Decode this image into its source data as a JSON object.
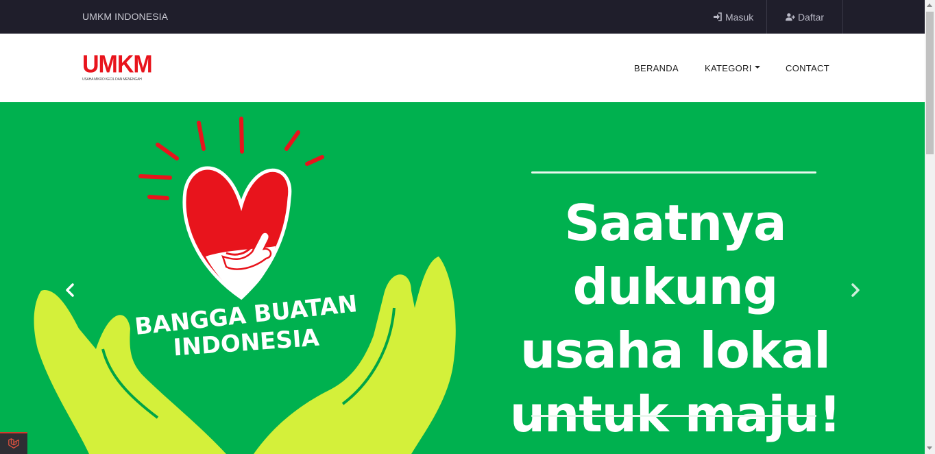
{
  "topbar": {
    "brand": "UMKM INDONESIA",
    "login_label": "Masuk",
    "register_label": "Daftar",
    "login_icon": "sign-in-icon",
    "register_icon": "user-plus-icon"
  },
  "logo": {
    "wordmark": "UMKM",
    "tagline": "USAHA MIKRO KECIL DAN MENENGAH"
  },
  "nav": {
    "items": [
      {
        "label": "BERANDA"
      },
      {
        "label": "KATEGORI",
        "has_dropdown": true
      },
      {
        "label": "CONTACT"
      }
    ]
  },
  "hero": {
    "badge_line1": "BANGGA BUATAN",
    "badge_line2": "INDONESIA",
    "headline_line1": "Saatnya dukung",
    "headline_line2": "usaha lokal",
    "headline_line3": "untuk maju!",
    "prev_icon": "chevron-left-icon",
    "next_icon": "chevron-right-icon"
  },
  "colors": {
    "topbar_bg": "#1f1e2b",
    "hero_bg": "#00b14f",
    "brand_red": "#e8141c",
    "hands": "#d4f03a"
  },
  "debug": {
    "icon": "laravel-icon"
  }
}
